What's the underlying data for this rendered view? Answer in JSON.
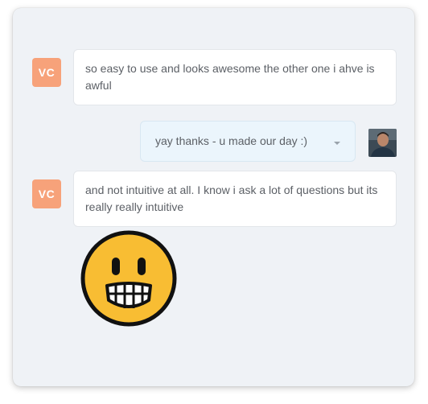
{
  "messages": [
    {
      "avatar_initials": "VC",
      "text": "so easy to use and looks awesome the other one i ahve is awful"
    },
    {
      "text": "yay thanks - u made our day :)"
    },
    {
      "avatar_initials": "VC",
      "text": "and not intuitive at all. I know i ask a lot of questions but its really really intuitive"
    }
  ],
  "emoji": "grinning-face-emoji",
  "colors": {
    "card_background": "#eff2f6",
    "agent_avatar": "#f7a27a",
    "outgoing_bubble": "#ebf5fc",
    "emoji_yellow": "#f8bd33"
  }
}
